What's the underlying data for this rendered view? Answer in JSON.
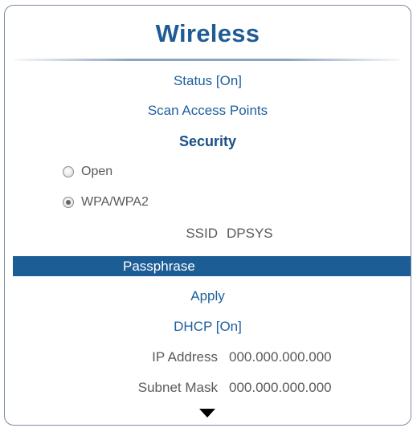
{
  "window": {
    "title": "Wireless"
  },
  "menu": {
    "status": "Status [On]",
    "scan_access_points": "Scan Access Points",
    "security_heading": "Security",
    "security_options": [
      {
        "label": "Open",
        "selected": false
      },
      {
        "label": "WPA/WPA2",
        "selected": true
      }
    ],
    "ssid": {
      "label": "SSID",
      "value": "DPSYS"
    },
    "passphrase": "Passphrase",
    "apply": "Apply",
    "dhcp": "DHCP [On]",
    "ip_address": {
      "label": "IP Address",
      "value": "000.000.000.000"
    },
    "subnet_mask": {
      "label": "Subnet Mask",
      "value": "000.000.000.000"
    }
  },
  "icons": {
    "scroll_down": "down-arrow-icon"
  },
  "colors": {
    "title": "#1f5c95",
    "link": "#1e5f9e",
    "selection_bar": "#1d5d95",
    "muted_text": "#5a5a5a"
  }
}
